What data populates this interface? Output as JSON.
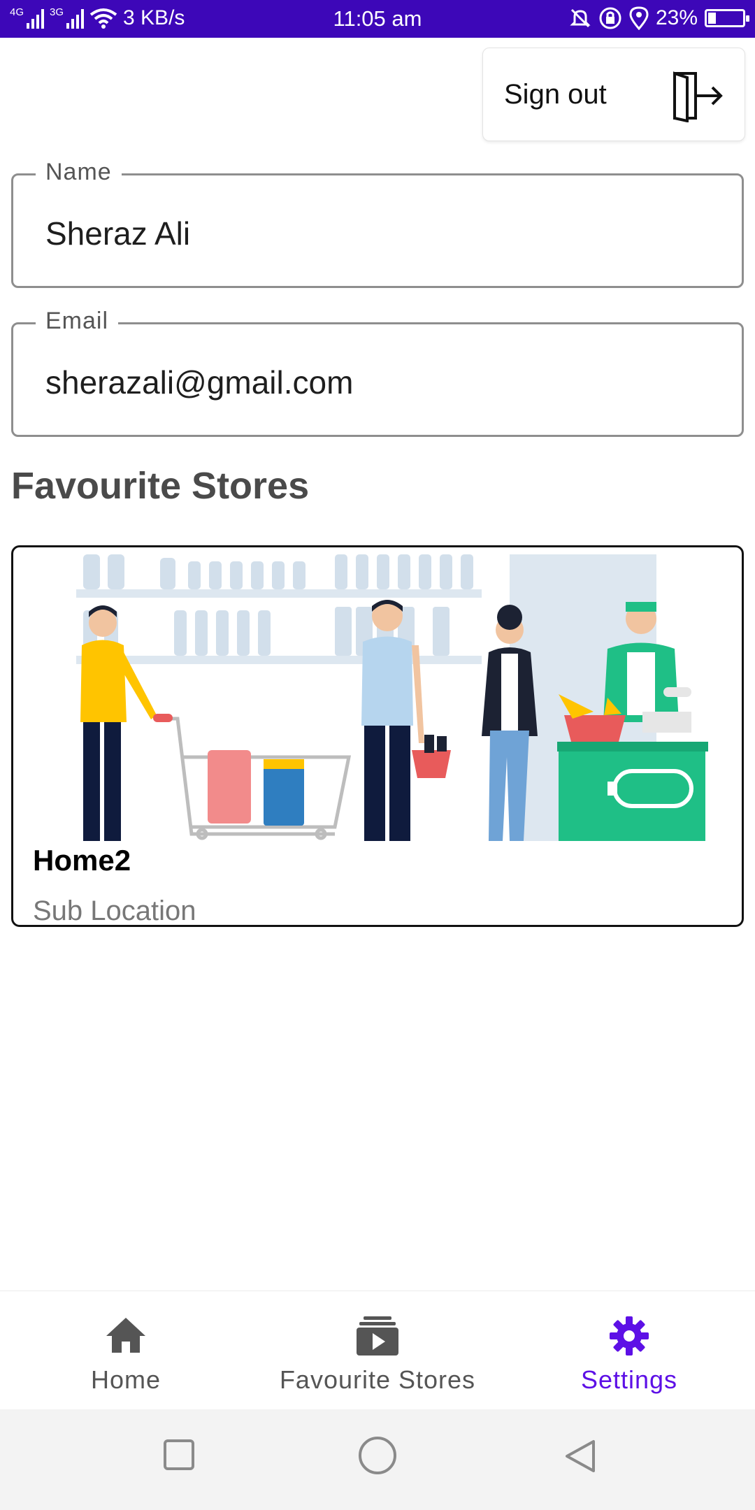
{
  "status_bar": {
    "network_1": "4G",
    "network_2": "3G",
    "speed": "3 KB/s",
    "time": "11:05 am",
    "battery": "23%",
    "battery_level": 0.23
  },
  "header": {
    "sign_out_label": "Sign out"
  },
  "form": {
    "name_label": "Name",
    "name_value": "Sheraz Ali",
    "email_label": "Email",
    "email_value": "sherazali@gmail.com"
  },
  "favourites": {
    "title": "Favourite Stores",
    "stores": [
      {
        "name": "Home2",
        "sub_location": "Sub Location"
      }
    ]
  },
  "bottom_nav": {
    "items": [
      {
        "label": "Home",
        "icon": "home-icon",
        "active": false
      },
      {
        "label": "Favourite Stores",
        "icon": "video-library-icon",
        "active": false
      },
      {
        "label": "Settings",
        "icon": "gear-icon",
        "active": true
      }
    ]
  },
  "colors": {
    "status_bar": "#3d07b8",
    "active": "#5d10e6",
    "inactive": "#555555",
    "store_green": "#1fbf86"
  }
}
